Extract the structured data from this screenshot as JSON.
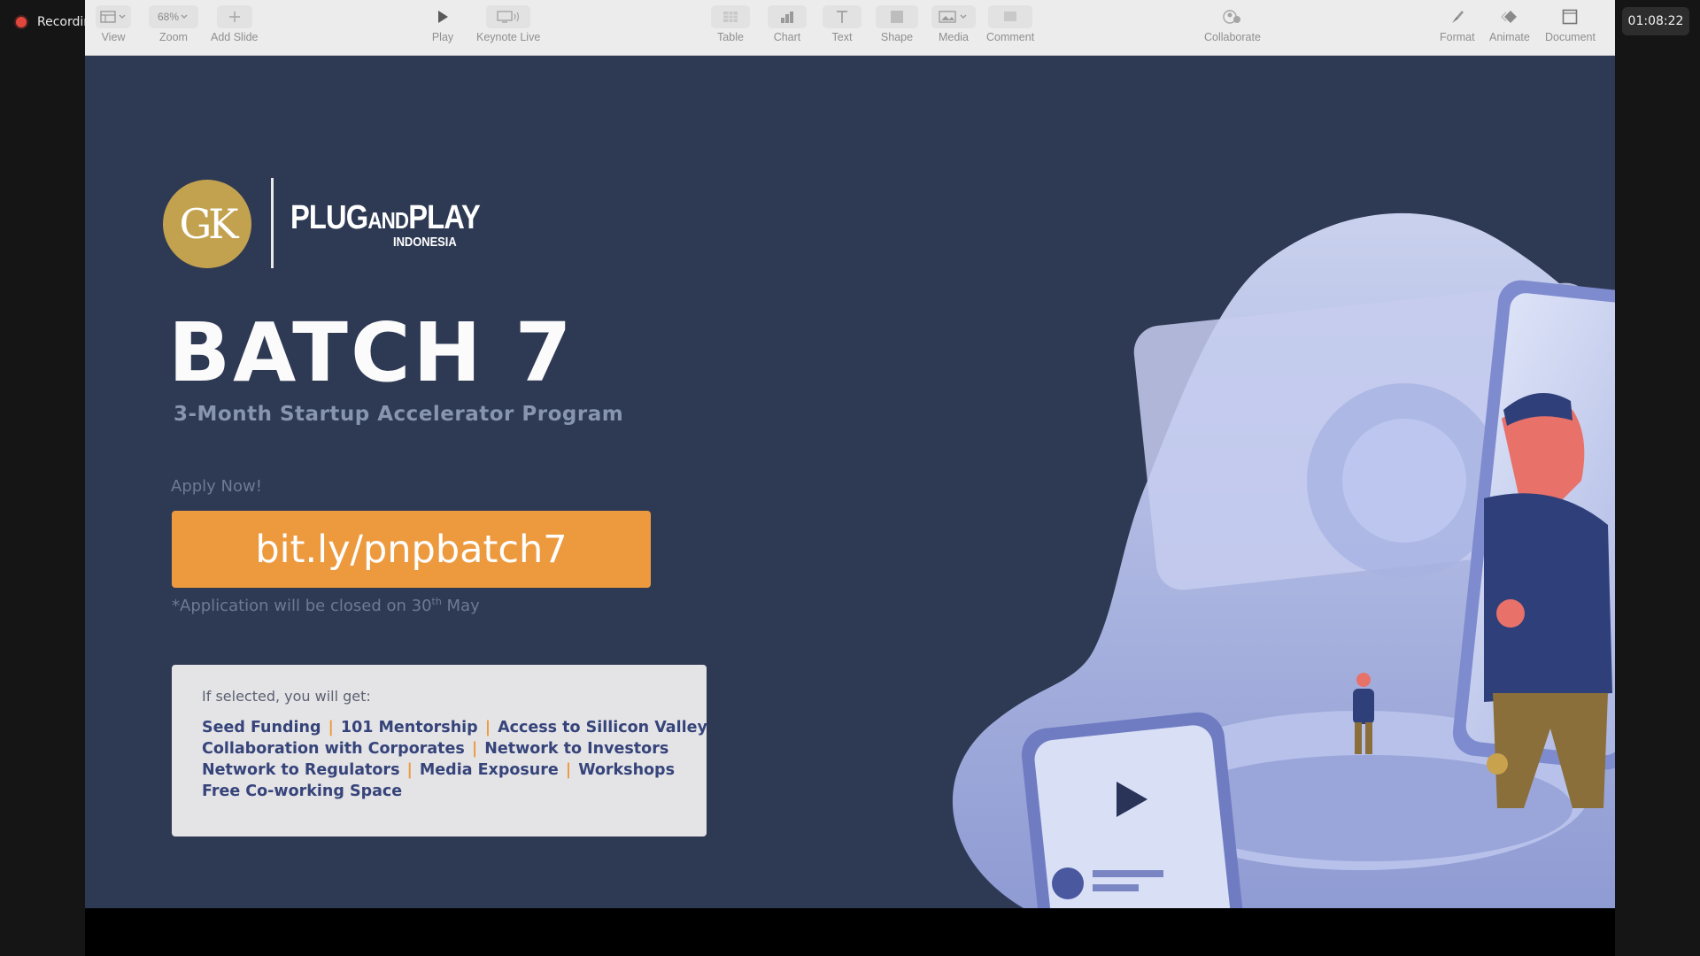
{
  "recording": {
    "label": "Recording"
  },
  "clock": {
    "time": "01:08:22"
  },
  "toolbar": {
    "view": "View",
    "zoom_value": "68%",
    "zoom": "Zoom",
    "add_slide": "Add Slide",
    "play": "Play",
    "keynote_live": "Keynote Live",
    "table": "Table",
    "chart": "Chart",
    "text": "Text",
    "shape": "Shape",
    "media": "Media",
    "comment": "Comment",
    "collaborate": "Collaborate",
    "format": "Format",
    "animate": "Animate",
    "document": "Document"
  },
  "slide": {
    "logo_gk": "GK",
    "brand_plug": "PLUG",
    "brand_and": "AND",
    "brand_play": "PLAY",
    "brand_country": "INDONESIA",
    "title": "BATCH 7",
    "subtitle": "3-Month Startup Accelerator Program",
    "apply_label": "Apply Now!",
    "cta_link": "bit.ly/pnpbatch7",
    "note_prefix": "*Application will be closed on 30",
    "note_sup": "th",
    "note_suffix": " May",
    "benefits_title": "If selected, you will get:",
    "benefits": {
      "b1": "Seed Funding",
      "b2": "101 Mentorship",
      "b3": "Access to Sillicon Valley",
      "b4": "Collaboration with Corporates",
      "b5": "Network to Investors",
      "b6": "Network to Regulators",
      "b7": "Media Exposure",
      "b8": "Workshops",
      "b9": "Free Co-working Space"
    },
    "separator": "|"
  },
  "colors": {
    "slide_background": "#2e3a54",
    "accent_orange": "#ed9a3f",
    "gold_logo": "#c3a24f",
    "benefit_text": "#36447a"
  }
}
